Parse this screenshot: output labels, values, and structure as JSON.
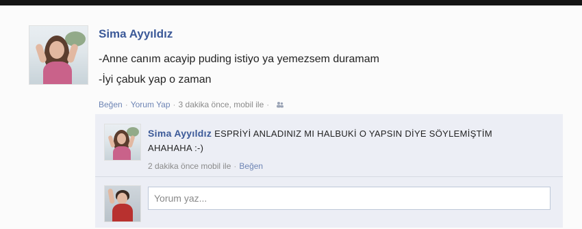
{
  "post": {
    "author": "Sima Ayyıldız",
    "lines": [
      "-Anne canım acayip puding istiyo ya yemezsem duramam",
      "-İyi çabuk yap o zaman"
    ],
    "actions": {
      "like": "Beğen",
      "comment": "Yorum Yap",
      "time": "3 dakika önce, mobil ile"
    },
    "privacy_icon": "friends-icon"
  },
  "reply": {
    "author": "Sima Ayyıldız",
    "text": "ESPRİYİ ANLADINIZ MI HALBUKİ O YAPSIN DİYE SÖYLEMİŞTİM AHAHAHA :-)",
    "time": "2 dakika önce mobil ile",
    "like": "Beğen"
  },
  "comment_box": {
    "placeholder": "Yorum yaz..."
  },
  "colors": {
    "link": "#3b5998",
    "meta_link": "#6d84b4",
    "thread_bg": "#eceef5"
  }
}
